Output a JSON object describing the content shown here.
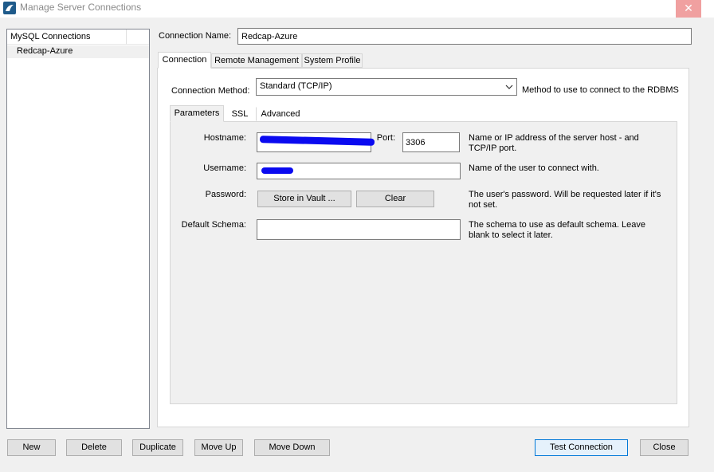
{
  "window": {
    "title": "Manage Server Connections",
    "close_glyph": "✕"
  },
  "sidebar": {
    "header": "MySQL Connections",
    "items": [
      {
        "label": "Redcap-Azure"
      }
    ]
  },
  "connection_name": {
    "label": "Connection Name:",
    "value": "Redcap-Azure"
  },
  "outer_tabs": [
    {
      "label": "Connection",
      "active": true
    },
    {
      "label": "Remote Management",
      "active": false
    },
    {
      "label": "System Profile",
      "active": false
    }
  ],
  "connection_method": {
    "label": "Connection Method:",
    "value": "Standard (TCP/IP)",
    "description": "Method to use to connect to the RDBMS"
  },
  "inner_tabs": [
    {
      "label": "Parameters",
      "active": true
    },
    {
      "label": "SSL",
      "active": false
    },
    {
      "label": "Advanced",
      "active": false
    }
  ],
  "parameters": {
    "hostname": {
      "label": "Hostname:",
      "value": "",
      "description": "Name or IP address of the server host - and TCP/IP port."
    },
    "port": {
      "label": "Port:",
      "value": "3306"
    },
    "username": {
      "label": "Username:",
      "value": "",
      "description": "Name of the user to connect with."
    },
    "password": {
      "label": "Password:",
      "store_button": "Store in Vault ...",
      "clear_button": "Clear",
      "description": "The user's password. Will be requested later if it's not set."
    },
    "default_schema": {
      "label": "Default Schema:",
      "value": "",
      "description": "The schema to use as default schema. Leave blank to select it later."
    }
  },
  "bottom_buttons": {
    "new": "New",
    "delete": "Delete",
    "duplicate": "Duplicate",
    "move_up": "Move Up",
    "move_down": "Move Down",
    "test_connection": "Test Connection",
    "close": "Close"
  },
  "colors": {
    "accent": "#0078d7",
    "redaction": "#0a0af0"
  },
  "icons": {
    "app": "mysql-workbench-icon",
    "dropdown": "chevron-down-icon"
  }
}
